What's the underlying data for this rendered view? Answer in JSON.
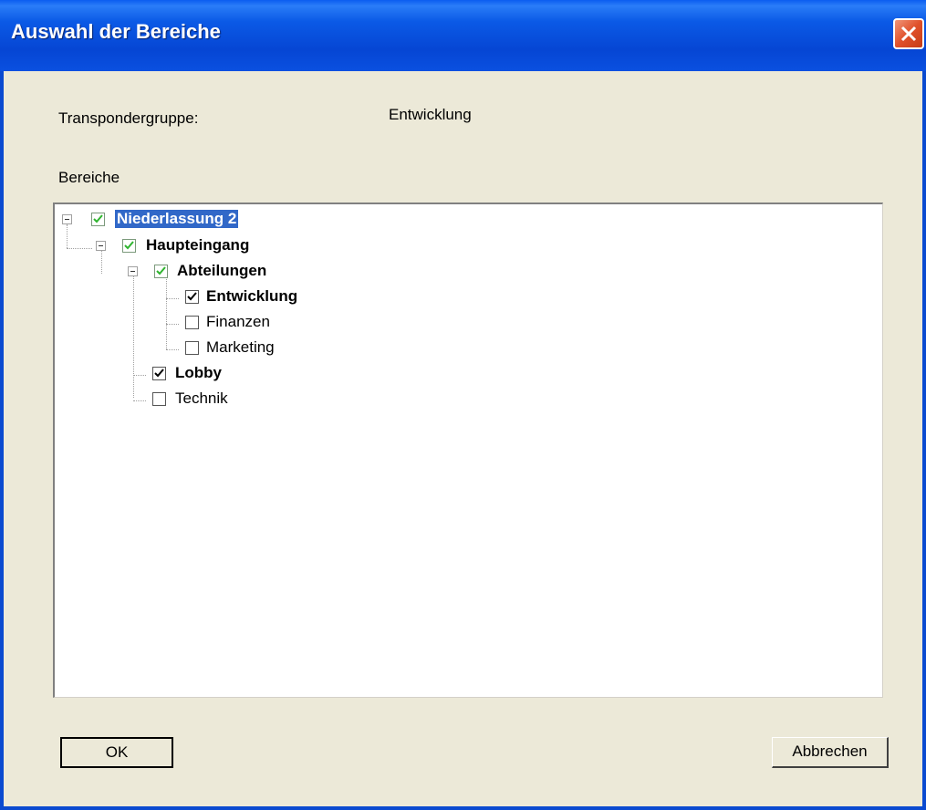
{
  "window": {
    "title": "Auswahl der Bereiche"
  },
  "form": {
    "group_label": "Transpondergruppe:",
    "group_value": "Entwicklung",
    "areas_label": "Bereiche"
  },
  "tree": {
    "root": {
      "label": "Niederlassung 2",
      "checked": true,
      "selected": true
    },
    "haupteingang": {
      "label": "Haupteingang",
      "checked": true
    },
    "abteilungen": {
      "label": "Abteilungen",
      "checked": true
    },
    "entwicklung": {
      "label": "Entwicklung",
      "checked": true
    },
    "finanzen": {
      "label": "Finanzen",
      "checked": false
    },
    "marketing": {
      "label": "Marketing",
      "checked": false
    },
    "lobby": {
      "label": "Lobby",
      "checked": true
    },
    "technik": {
      "label": "Technik",
      "checked": false
    }
  },
  "buttons": {
    "ok": "OK",
    "cancel": "Abbrechen"
  },
  "colors": {
    "titlebar": "#0646d4",
    "selection": "#3168c8",
    "green_check": "#2fb52f",
    "close": "#e0502a"
  }
}
